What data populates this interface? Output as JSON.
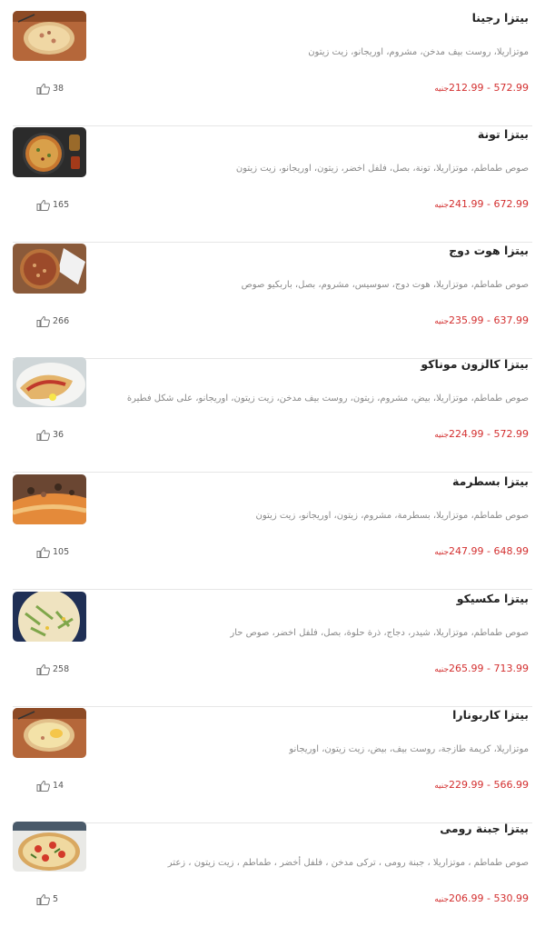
{
  "currency": "جنيه",
  "items": [
    {
      "name": "بيتزا رجينا",
      "description": "موتزاريلا، روست بيف مدخن، مشروم، اوريجانو، زيت زيتون",
      "price_range": "572.99 - 212.99",
      "likes": "38",
      "image_icon": "pizza-regina-image"
    },
    {
      "name": "بيتزا تونة",
      "description": "صوص طماطم، موتزاريلا، تونة، بصل، فلفل اخضر، زيتون، اوريجانو، زيت زيتون",
      "price_range": "672.99 - 241.99",
      "likes": "165",
      "image_icon": "pizza-tuna-image"
    },
    {
      "name": "بيتزا هوت دوج",
      "description": "صوص طماطم، موتزاريلا، هوت دوج، سوسيس، مشروم، بصل، باربكيو صوص",
      "price_range": "637.99 - 235.99",
      "likes": "266",
      "image_icon": "pizza-hotdog-image"
    },
    {
      "name": "بيتزا كالزون موناكو",
      "description": "صوص طماطم، موتزاريلا، بيض، مشروم، زيتون، روست بيف مدخن، زيت زيتون، اوريجانو، على شكل فطيرة",
      "price_range": "572.99 - 224.99",
      "likes": "36",
      "image_icon": "pizza-calzone-image"
    },
    {
      "name": "بيتزا بسطرمة",
      "description": "صوص طماطم، موتزاريلا، بسطرمة، مشروم، زيتون، اوريجانو، زيت زيتون",
      "price_range": "648.99 - 247.99",
      "likes": "105",
      "image_icon": "pizza-basterma-image"
    },
    {
      "name": "بيتزا مكسيكو",
      "description": "صوص طماطم، موتزاريلا، شيدر، دجاج، ذرة حلوة، بصل، فلفل اخضر، صوص حار",
      "price_range": "713.99 - 265.99",
      "likes": "258",
      "image_icon": "pizza-mexico-image"
    },
    {
      "name": "بيتزا كاربونارا",
      "description": "موتزاريلا، كريمة طازجة، روست بيف، بيض، زيت زيتون، اوريجانو",
      "price_range": "566.99 - 229.99",
      "likes": "14",
      "image_icon": "pizza-carbonara-image"
    },
    {
      "name": "بيتزا جبنة رومى",
      "description": "صوص طماطم ، موتزاريلا ، جبنة رومى ، تركى مدخن ، فلفل أخضر ، طماطم ، زيت زيتون ، زعتر",
      "price_range": "530.99 - 206.99",
      "likes": "5",
      "image_icon": "pizza-roumi-image"
    }
  ]
}
